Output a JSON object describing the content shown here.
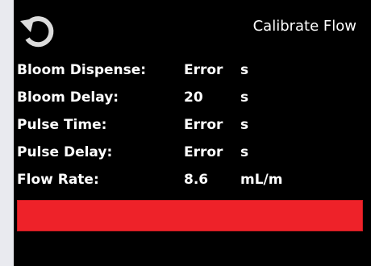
{
  "header": {
    "title": "Calibrate Flow",
    "back_icon": "refresh-back-icon"
  },
  "params": [
    {
      "label": "Bloom Dispense:",
      "value": "Error",
      "unit": "s"
    },
    {
      "label": "Bloom Delay:",
      "value": "20",
      "unit": "s"
    },
    {
      "label": "Pulse Time:",
      "value": "Error",
      "unit": "s"
    },
    {
      "label": "Pulse Delay:",
      "value": "Error",
      "unit": "s"
    },
    {
      "label": "Flow Rate:",
      "value": "8.6",
      "unit": "mL/m"
    }
  ],
  "colors": {
    "screen_background": "#000000",
    "bezel": "#e9eaef",
    "text": "#ffffff",
    "status_bar": "#ee2229"
  }
}
